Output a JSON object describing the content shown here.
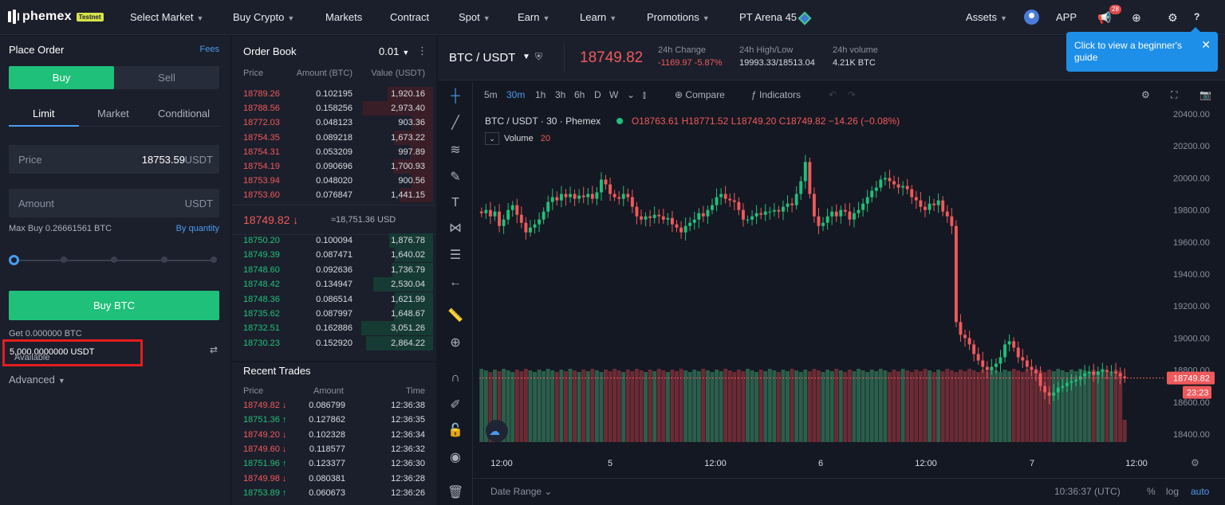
{
  "nav": {
    "logo": "phemex",
    "testnet": "Testnet",
    "items": [
      "Select Market",
      "Buy Crypto",
      "Markets",
      "Contract",
      "Spot",
      "Earn",
      "Learn",
      "Promotions",
      "PT Arena 45"
    ],
    "assets": "Assets",
    "app": "APP",
    "notifications": "28"
  },
  "tooltip": {
    "text": "Click to view a beginner's guide"
  },
  "order_panel": {
    "title": "Place Order",
    "fees": "Fees",
    "buy": "Buy",
    "sell": "Sell",
    "tabs": [
      "Limit",
      "Market",
      "Conditional"
    ],
    "price_label": "Price",
    "price_value": "18753.59",
    "price_unit": "USDT",
    "amount_label": "Amount",
    "amount_unit": "USDT",
    "max_buy": "Max Buy 0.26661561 BTC",
    "by_quantity": "By quantity",
    "slider_value": 0,
    "buy_button": "Buy BTC",
    "get": "Get 0.000000 BTC",
    "available_label": "Available",
    "available_value": "5,000.0000000 USDT",
    "advanced": "Advanced"
  },
  "order_book": {
    "title": "Order Book",
    "precision": "0.01",
    "headers": [
      "Price",
      "Amount (BTC)",
      "Value (USDT)"
    ],
    "asks": [
      {
        "price": "18789.26",
        "amount": "0.102195",
        "value": "1,920.16"
      },
      {
        "price": "18788.56",
        "amount": "0.158256",
        "value": "2,973.40"
      },
      {
        "price": "18772.03",
        "amount": "0.048123",
        "value": "903.36"
      },
      {
        "price": "18754.35",
        "amount": "0.089218",
        "value": "1,673.22"
      },
      {
        "price": "18754.31",
        "amount": "0.053209",
        "value": "997.89"
      },
      {
        "price": "18754.19",
        "amount": "0.090696",
        "value": "1,700.93"
      },
      {
        "price": "18753.94",
        "amount": "0.048020",
        "value": "900.56"
      },
      {
        "price": "18753.60",
        "amount": "0.076847",
        "value": "1,441.15"
      }
    ],
    "mid_price": "18749.82 ↓",
    "mid_usd": "≈18,751.36 USD",
    "bids": [
      {
        "price": "18750.20",
        "amount": "0.100094",
        "value": "1,876.78"
      },
      {
        "price": "18749.39",
        "amount": "0.087471",
        "value": "1,640.02"
      },
      {
        "price": "18748.60",
        "amount": "0.092636",
        "value": "1,736.79"
      },
      {
        "price": "18748.42",
        "amount": "0.134947",
        "value": "2,530.04"
      },
      {
        "price": "18748.36",
        "amount": "0.086514",
        "value": "1,621.99"
      },
      {
        "price": "18735.62",
        "amount": "0.087997",
        "value": "1,648.67"
      },
      {
        "price": "18732.51",
        "amount": "0.162886",
        "value": "3,051.26"
      },
      {
        "price": "18730.23",
        "amount": "0.152920",
        "value": "2,864.22"
      }
    ]
  },
  "recent_trades": {
    "title": "Recent Trades",
    "headers": [
      "Price",
      "Amount",
      "Time"
    ],
    "rows": [
      {
        "price": "18749.82 ↓",
        "amount": "0.086799",
        "time": "12:36:38",
        "side": "sell"
      },
      {
        "price": "18751.36 ↑",
        "amount": "0.127862",
        "time": "12:36:35",
        "side": "buy"
      },
      {
        "price": "18749.20 ↓",
        "amount": "0.102328",
        "time": "12:36:34",
        "side": "sell"
      },
      {
        "price": "18749.60 ↓",
        "amount": "0.118577",
        "time": "12:36:32",
        "side": "sell"
      },
      {
        "price": "18751.96 ↑",
        "amount": "0.123377",
        "time": "12:36:30",
        "side": "buy"
      },
      {
        "price": "18749.98 ↓",
        "amount": "0.080381",
        "time": "12:36:28",
        "side": "sell"
      },
      {
        "price": "18753.89 ↑",
        "amount": "0.060673",
        "time": "12:36:26",
        "side": "buy"
      }
    ]
  },
  "ticker": {
    "symbol": "BTC / USDT",
    "last_price": "18749.82",
    "change_label": "24h Change",
    "change_value": "-1169.97 -5.87%",
    "hl_label": "24h High/Low",
    "hl_value": "19993.33/18513.04",
    "vol_label": "24h volume",
    "vol_value": "4.21K BTC"
  },
  "chart_toolbar": {
    "intervals": [
      "5m",
      "30m",
      "1h",
      "3h",
      "6h",
      "D",
      "W"
    ],
    "active_interval": "30m",
    "compare": "Compare",
    "indicators": "Indicators"
  },
  "chart_legend": {
    "title": "BTC / USDT · 30 · Phemex",
    "ohlc": "O18763.61 H18771.52 L18749.20 C18749.82 −14.26 (−0.08%)",
    "volume_label": "Volume",
    "volume_value": "20"
  },
  "chart_data": {
    "type": "candlestick",
    "y_ticks": [
      "20400.00",
      "20200.00",
      "20000.00",
      "19800.00",
      "19600.00",
      "19400.00",
      "19200.00",
      "19000.00",
      "18800.00",
      "18600.00",
      "18400.00"
    ],
    "ylim": [
      18350,
      20450
    ],
    "x_ticks": [
      "12:00",
      "5",
      "12:00",
      "6",
      "12:00",
      "7",
      "12:00"
    ],
    "last_price_label": "18749.82",
    "countdown_label": "23:23",
    "closes": [
      19780,
      19800,
      19760,
      19790,
      19700,
      19740,
      19800,
      19830,
      19770,
      19720,
      19660,
      19690,
      19710,
      19740,
      19790,
      19850,
      19880,
      19860,
      19900,
      19880,
      19900,
      19870,
      19890,
      19880,
      19900,
      19870,
      19910,
      19990,
      19960,
      19900,
      19880,
      19870,
      19900,
      19880,
      19820,
      19760,
      19740,
      19760,
      19750,
      19770,
      19760,
      19740,
      19750,
      19710,
      19690,
      19660,
      19700,
      19720,
      19740,
      19780,
      19760,
      19800,
      19830,
      19880,
      19900,
      19870,
      19860,
      19850,
      19800,
      19740,
      19740,
      19760,
      19780,
      19770,
      19790,
      19790,
      19800,
      19790,
      19820,
      19840,
      19830,
      19900,
      19980,
      20100,
      19900,
      19760,
      19700,
      19720,
      19760,
      19790,
      19760,
      19800,
      19790,
      19740,
      19780,
      19800,
      19840,
      19880,
      19920,
      19940,
      19990,
      20000,
      19980,
      19960,
      19940,
      19950,
      19930,
      19880,
      19860,
      19820,
      19800,
      19840,
      19830,
      19860,
      19790,
      19760,
      19700,
      19100,
      19020,
      19000,
      18960,
      18900,
      18860,
      18820,
      18800,
      18820,
      18840,
      18880,
      18960,
      18980,
      18940,
      18880,
      18860,
      18820,
      18800,
      18780,
      18700,
      18660,
      18640,
      18660,
      18690,
      18700,
      18720,
      18730,
      18740,
      18760,
      18780,
      18790,
      18770,
      18790,
      18800,
      18790,
      18790,
      18780,
      18760,
      18749.82
    ]
  },
  "date_range": "Date Range",
  "clock": "10:36:37 (UTC)",
  "scale_opts": [
    "%",
    "log",
    "auto"
  ]
}
